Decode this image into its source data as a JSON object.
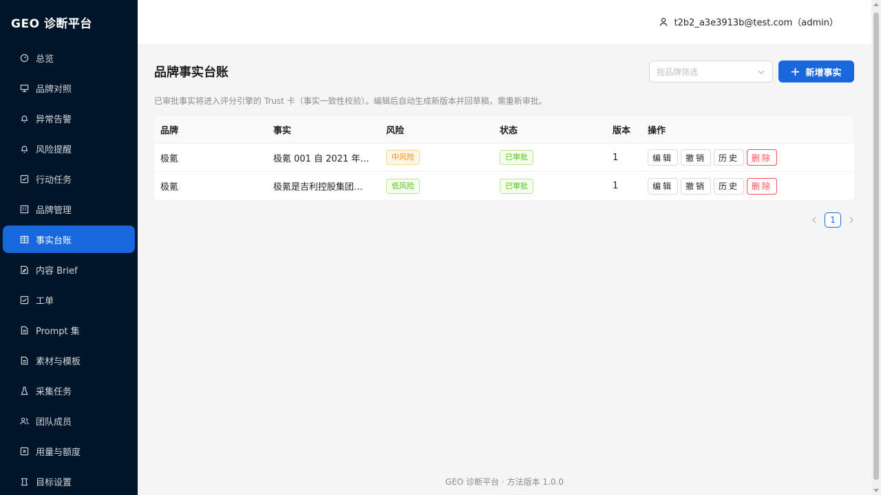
{
  "app": {
    "title": "GEO 诊断平台"
  },
  "sidebar": {
    "items": [
      {
        "label": "总览",
        "icon": "dashboard-icon"
      },
      {
        "label": "品牌对照",
        "icon": "compare-icon"
      },
      {
        "label": "异常告警",
        "icon": "alert-icon"
      },
      {
        "label": "风险提醒",
        "icon": "warning-icon"
      },
      {
        "label": "行动任务",
        "icon": "check-square-icon"
      },
      {
        "label": "品牌管理",
        "icon": "building-icon"
      },
      {
        "label": "事实台账",
        "icon": "ledger-icon",
        "active": true
      },
      {
        "label": "内容 Brief",
        "icon": "file-edit-icon"
      },
      {
        "label": "工单",
        "icon": "checklist-icon"
      },
      {
        "label": "Prompt 集",
        "icon": "document-icon"
      },
      {
        "label": "素材与模板",
        "icon": "template-icon"
      },
      {
        "label": "采集任务",
        "icon": "flask-icon"
      },
      {
        "label": "团队成员",
        "icon": "team-icon"
      },
      {
        "label": "用量与额度",
        "icon": "usage-icon"
      },
      {
        "label": "目标设置",
        "icon": "target-icon"
      }
    ]
  },
  "header": {
    "user": "t2b2_a3e3913b@test.com（admin）"
  },
  "main": {
    "title": "品牌事实台账",
    "filter_placeholder": "按品牌筛选",
    "add_label": "新增事实",
    "description": "已审批事实将进入评分引擎的 Trust 卡（事实一致性校验）。编辑后自动生成新版本并回草稿，需重新审批。",
    "table": {
      "columns": [
        "品牌",
        "事实",
        "风险",
        "状态",
        "版本",
        "操作"
      ],
      "rows": [
        {
          "brand": "极氪",
          "fact": "极氪 001 自 2021 年…",
          "risk": "中风险",
          "risk_level": "mid",
          "status": "已审批",
          "version": "1"
        },
        {
          "brand": "极氪",
          "fact": "极氪是吉利控股集团…",
          "risk": "低风险",
          "risk_level": "low",
          "status": "已审批",
          "version": "1"
        }
      ],
      "actions": {
        "edit": "编辑",
        "revoke": "撤销",
        "history": "历史",
        "delete": "删除"
      }
    },
    "pagination": {
      "current": "1"
    }
  },
  "footer": {
    "text": "GEO 诊断平台 · 方法版本 1.0.0"
  },
  "colors": {
    "sidebar_bg": "#001529",
    "accent": "#1668dc",
    "danger": "#ff4d4f"
  }
}
